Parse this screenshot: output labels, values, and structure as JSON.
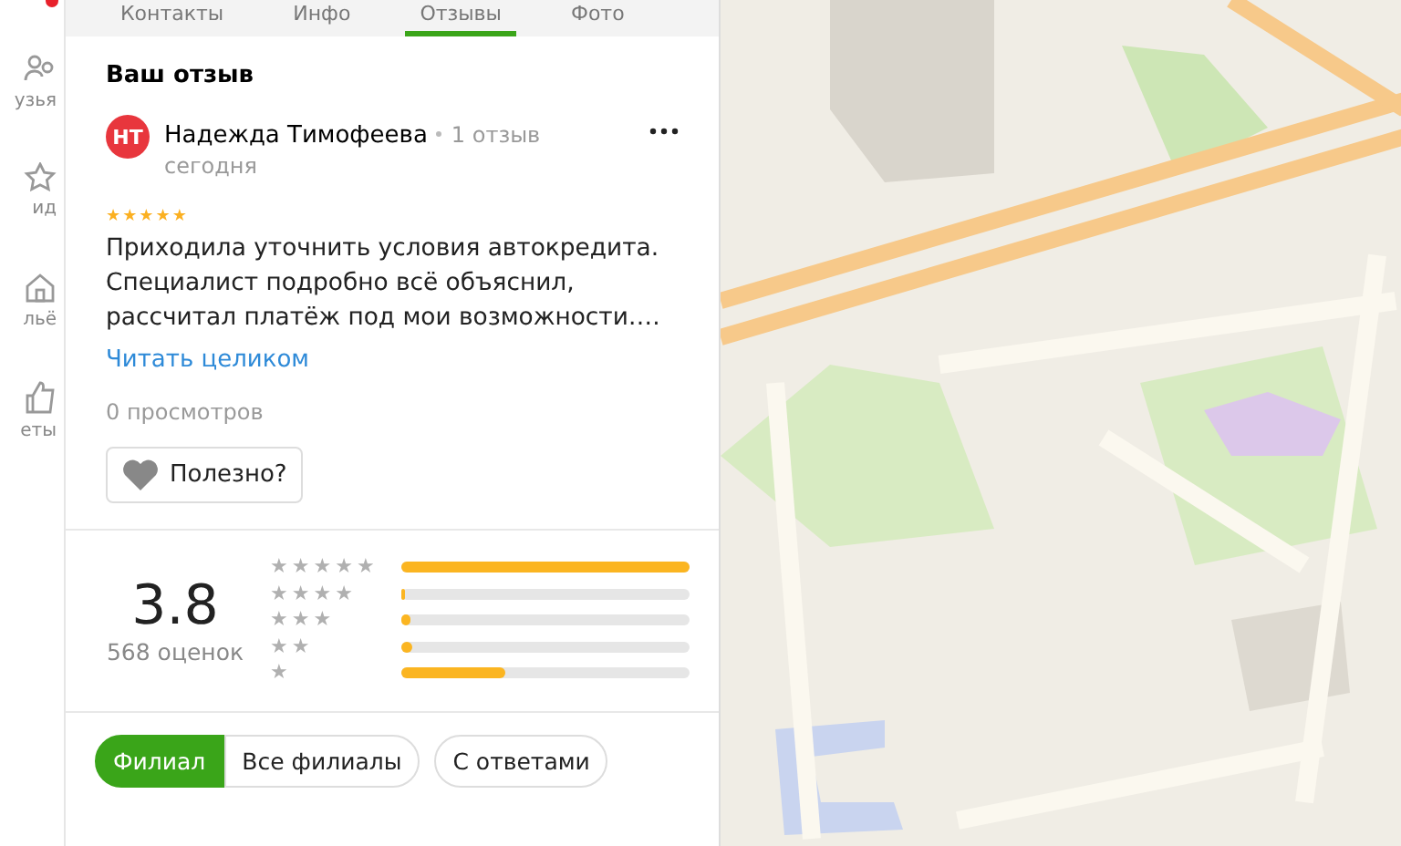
{
  "sidebar": {
    "items": [
      {
        "label": "узья",
        "kind": "people"
      },
      {
        "label": "ид",
        "kind": "guide"
      },
      {
        "label": "льё",
        "kind": "housing"
      },
      {
        "label": "еты",
        "kind": "like"
      }
    ],
    "notification": true
  },
  "tabs": [
    {
      "label": "Контакты",
      "selected": false
    },
    {
      "label": "Инфо",
      "selected": false
    },
    {
      "label": "Отзывы",
      "selected": true
    },
    {
      "label": "Фото",
      "selected": false
    }
  ],
  "review": {
    "title": "Ваш отзыв",
    "author": {
      "initials": "НТ",
      "name": "Надежда Тимофеева",
      "reviews_count": "1 отзыв",
      "date": "сегодня"
    },
    "stars": 5,
    "text": "Приходила уточнить условия автокредита. Специалист подробно всё объяснил, рассчитал платёж под мои возможности….",
    "read_more": "Читать целиком",
    "views": "0 просмотров",
    "helpful_button": "Полезно?"
  },
  "rating": {
    "score": "3.8",
    "count": "568 оценок",
    "distribution": [
      {
        "label": "★★★★★",
        "level": 1.0
      },
      {
        "label": "★★★★",
        "level": 0.015
      },
      {
        "label": "★★★",
        "level": 0.03
      },
      {
        "label": "★★",
        "level": 0.04
      },
      {
        "label": "★",
        "level": 0.36
      }
    ]
  },
  "filters": [
    {
      "label": "Филиал",
      "selected": true,
      "kind": "segment"
    },
    {
      "label": "Все филиалы",
      "selected": false,
      "kind": "segment"
    },
    {
      "label": "С ответами",
      "selected": false,
      "kind": "single"
    }
  ]
}
